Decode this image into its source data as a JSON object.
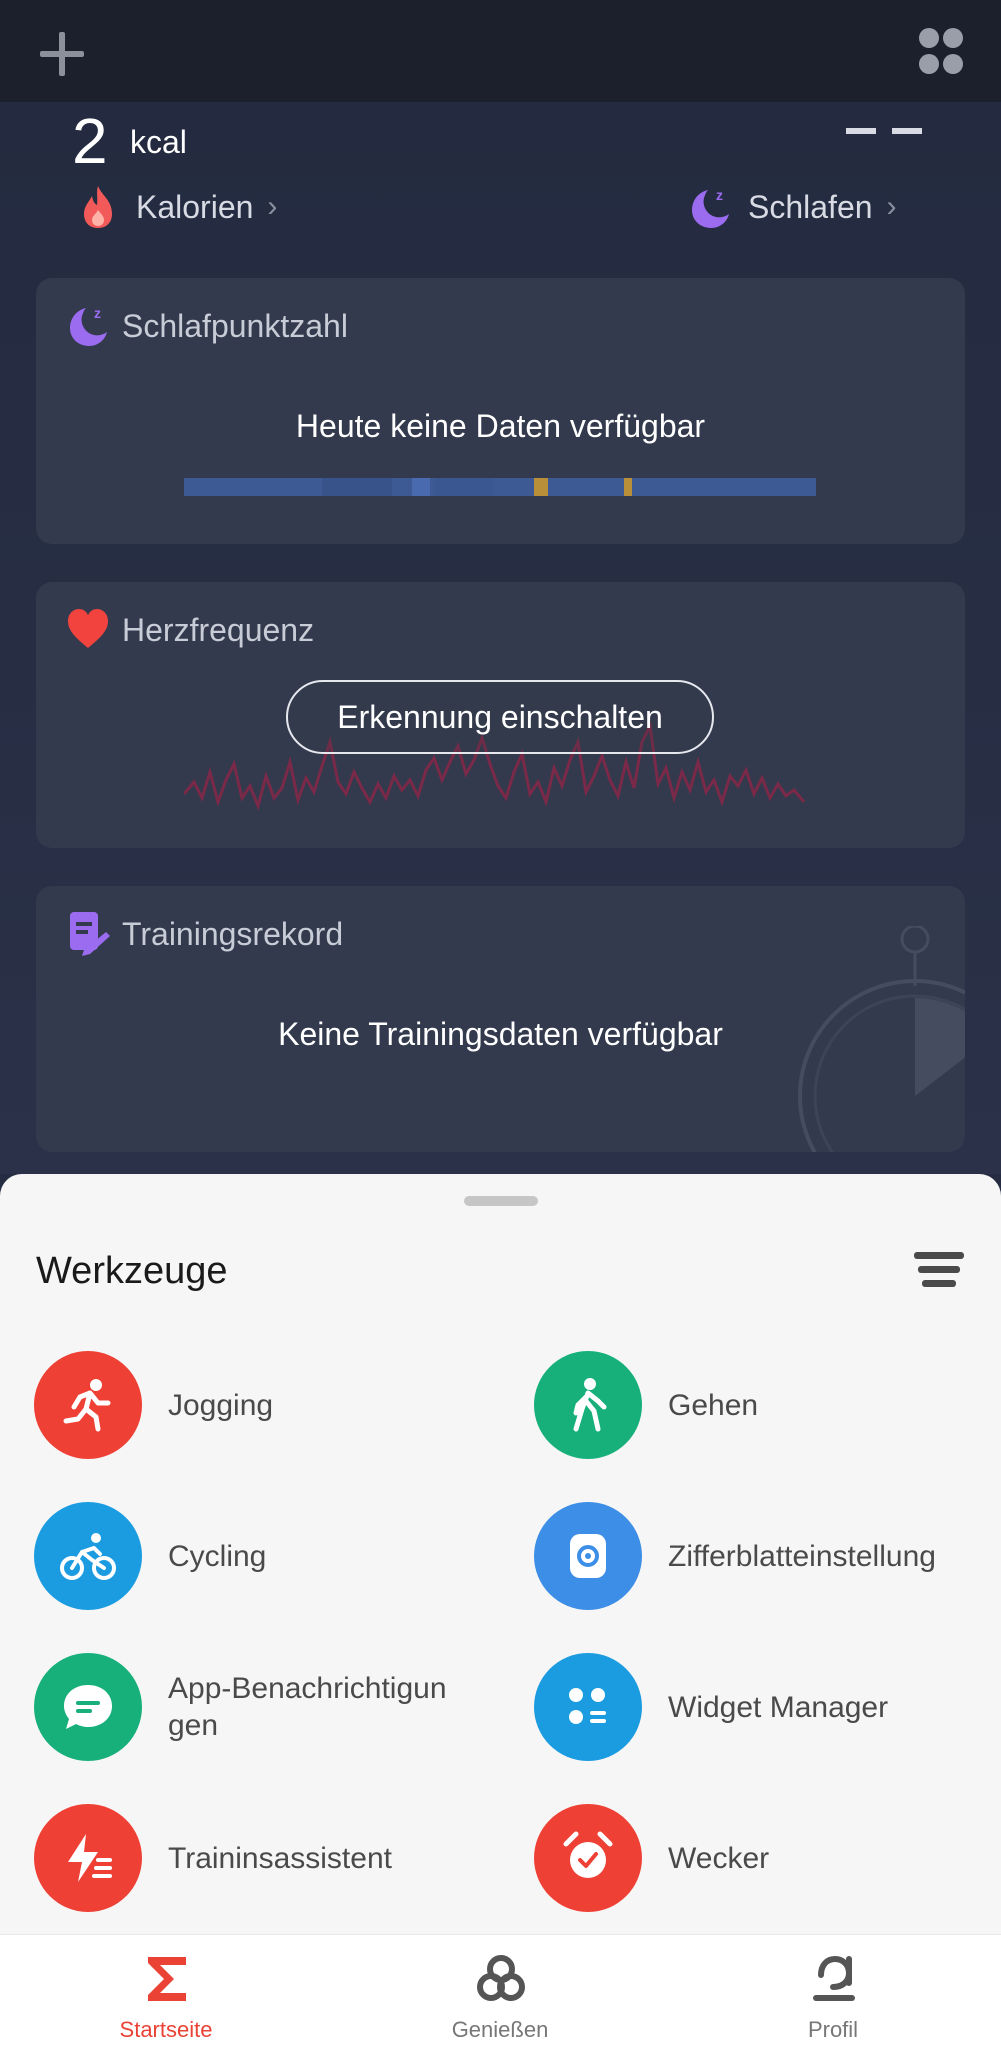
{
  "header": {
    "add_icon": "plus-icon",
    "apps_icon": "grid-icon"
  },
  "summary": {
    "calories_value": "2",
    "calories_unit": "kcal",
    "sleep_value": "– –",
    "calories_label": "Kalorien",
    "sleep_label": "Schlafen",
    "chevron": "›"
  },
  "cards": {
    "sleep_score": {
      "title": "Schlafpunktzahl",
      "message": "Heute keine Daten verfügbar"
    },
    "heart_rate": {
      "title": "Herzfrequenz",
      "button": "Erkennung einschalten"
    },
    "training": {
      "title": "Trainingsrekord",
      "message": "Keine Trainingsdaten verfügbar"
    }
  },
  "tools": {
    "title": "Werkzeuge",
    "items": [
      {
        "label": "Jogging",
        "color": "#ef4035",
        "icon": "running-icon"
      },
      {
        "label": "Gehen",
        "color": "#17b07b",
        "icon": "walking-icon"
      },
      {
        "label": "Cycling",
        "color": "#1b9ce0",
        "icon": "cycling-icon"
      },
      {
        "label": "Zifferblatteinstellung",
        "color": "#3d8ee6",
        "icon": "watchface-icon"
      },
      {
        "label": "App-Benachrichtigun gen",
        "label_line1": "App-Benachrichtigun",
        "label_line2": "gen",
        "color": "#17b07b",
        "icon": "chat-icon"
      },
      {
        "label": "Widget Manager",
        "color": "#1b9ce0",
        "icon": "widget-icon"
      },
      {
        "label": "Traininsassistent",
        "color": "#ef4035",
        "icon": "training-assistant-icon"
      },
      {
        "label": "Wecker",
        "color": "#ef4035",
        "icon": "alarm-icon"
      }
    ]
  },
  "nav": {
    "home": "Startseite",
    "enjoy": "Genießen",
    "profile": "Profil",
    "active_color": "#ea4335"
  }
}
